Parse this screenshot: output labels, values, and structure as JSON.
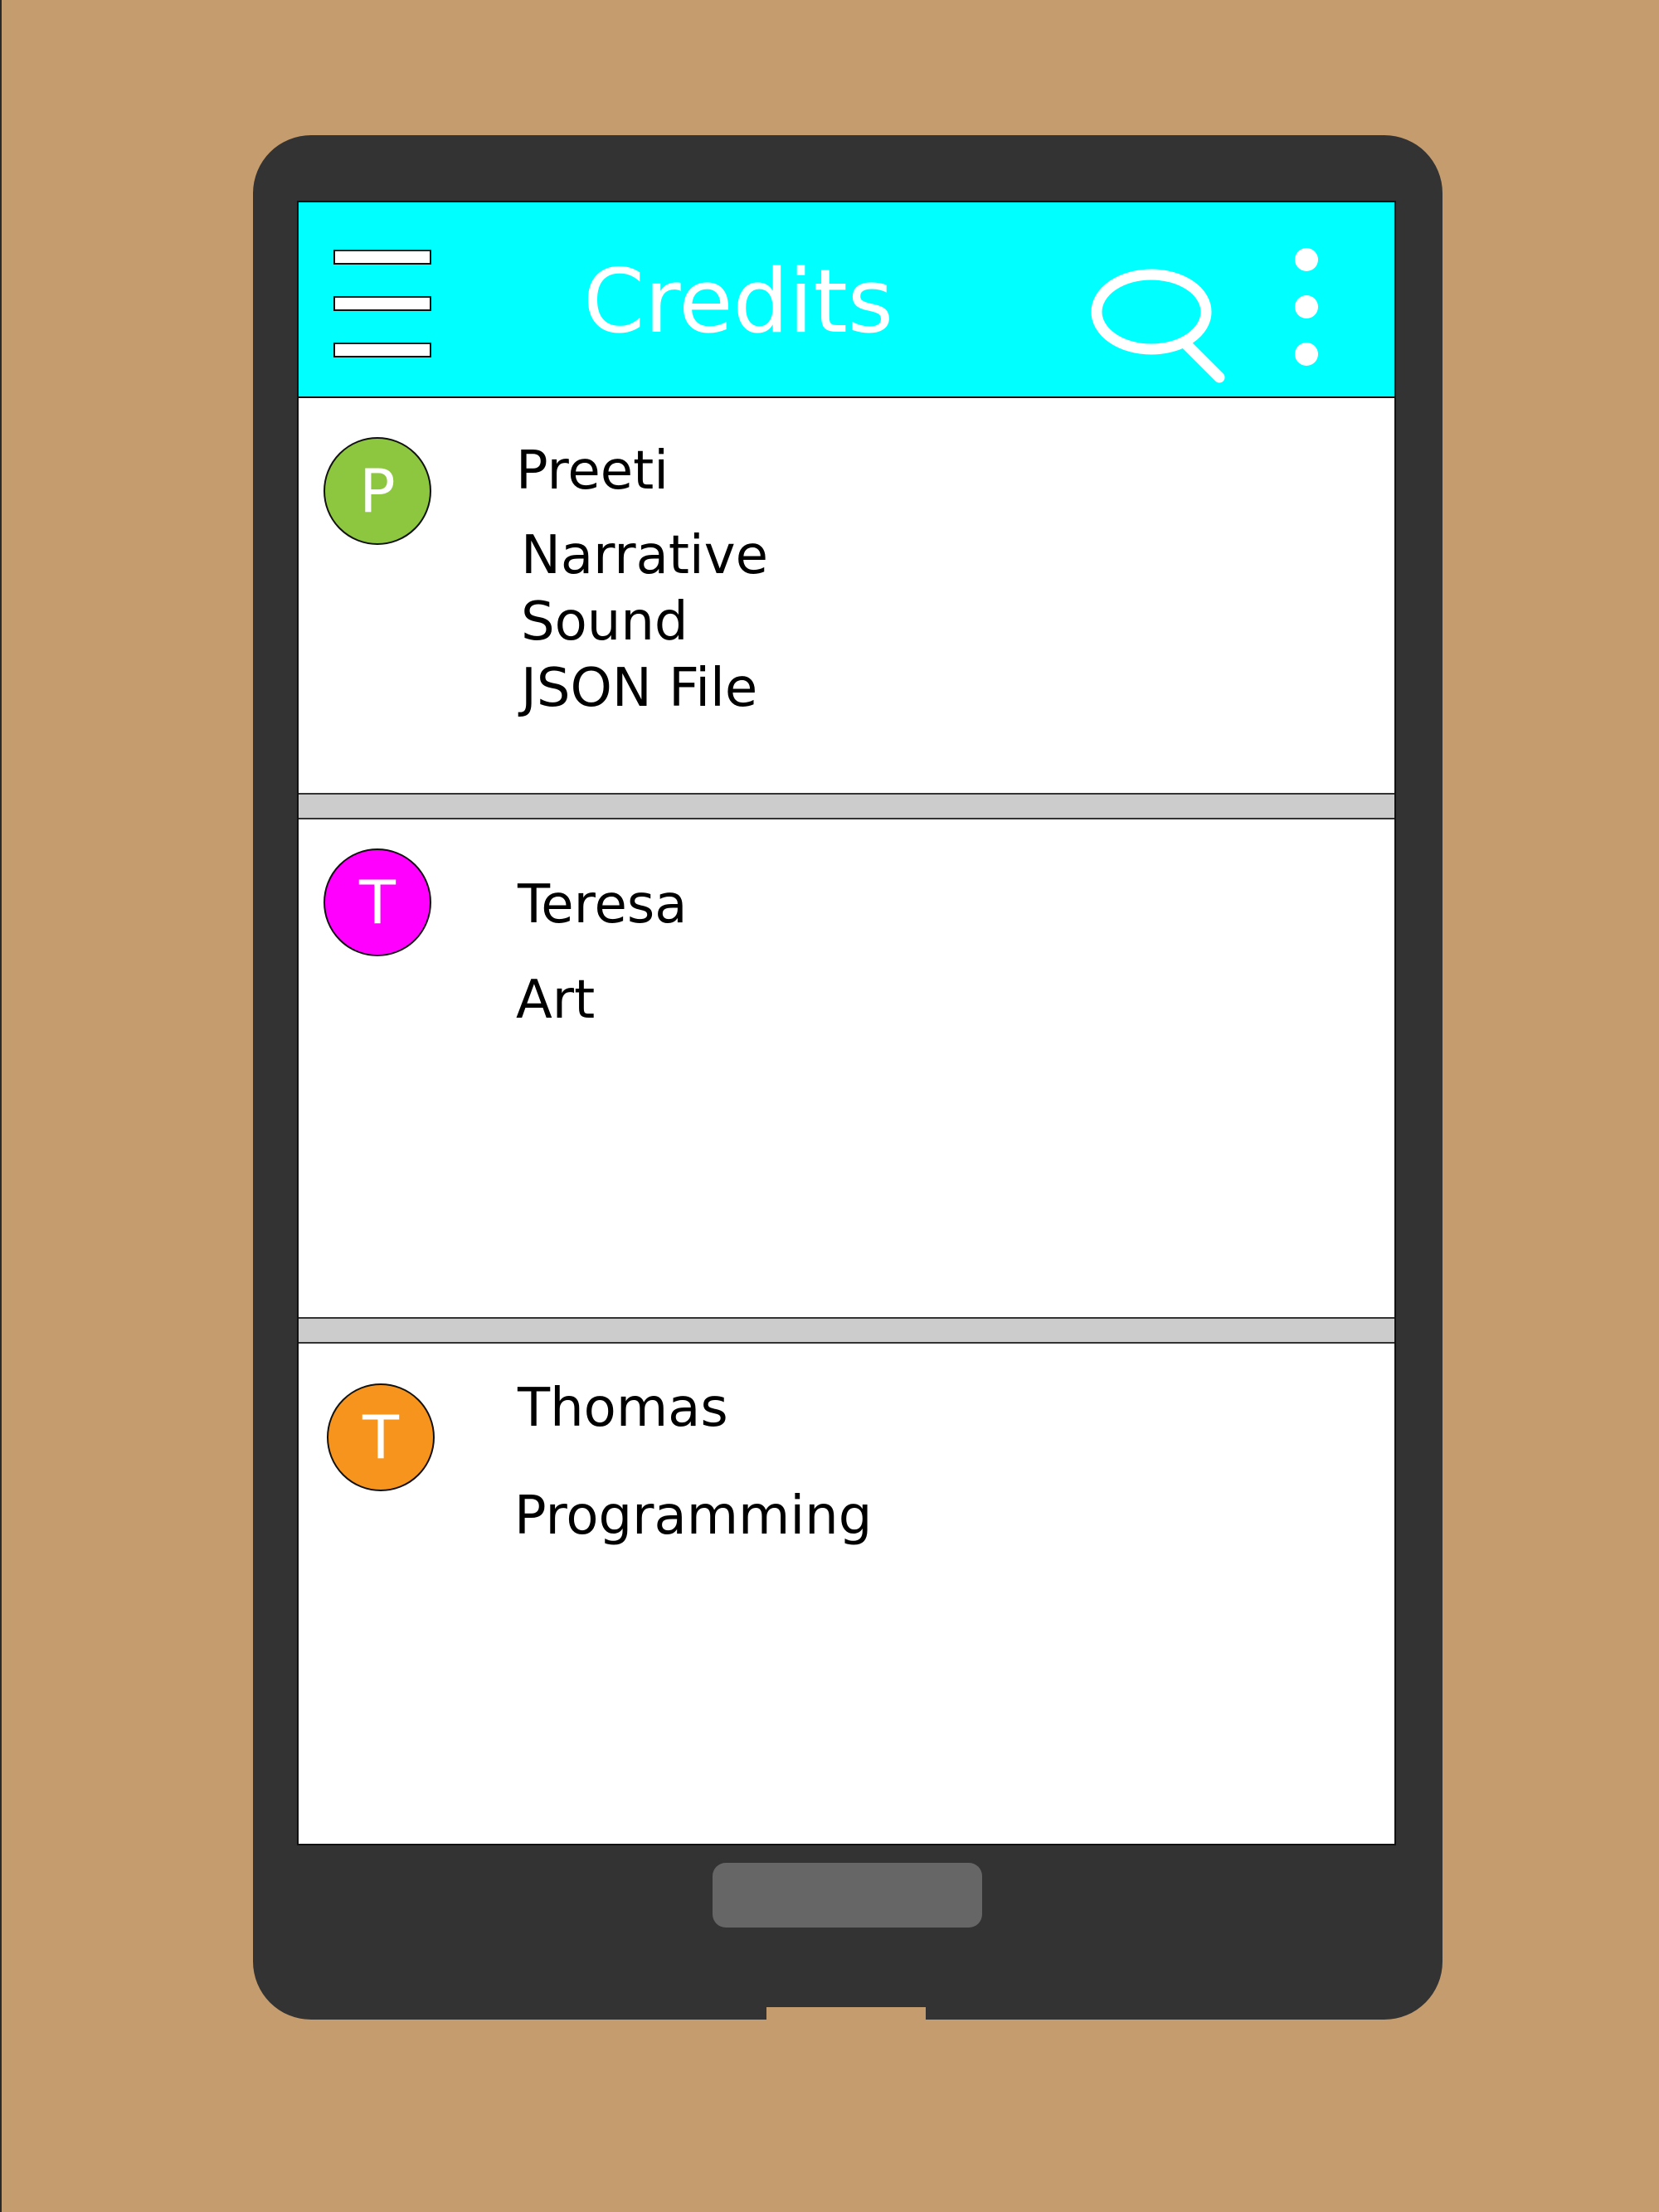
{
  "appbar": {
    "title": "Credits",
    "background": "#00ffff",
    "icons": [
      "menu-icon",
      "search-icon",
      "more-vert-icon"
    ]
  },
  "credits": [
    {
      "initial": "P",
      "name": "Preeti",
      "roles": [
        "Narrative",
        "Sound",
        "JSON File"
      ],
      "avatar_color": "#8dc63f"
    },
    {
      "initial": "T",
      "name": "Teresa",
      "roles": [
        "Art"
      ],
      "avatar_color": "#ff00ff"
    },
    {
      "initial": "T",
      "name": "Thomas",
      "roles": [
        "Programming"
      ],
      "avatar_color": "#f7941d"
    }
  ],
  "colors": {
    "desk_background": "#c59c6d",
    "device_frame": "#333333",
    "divider": "#cccccc",
    "home_button": "#666666"
  }
}
